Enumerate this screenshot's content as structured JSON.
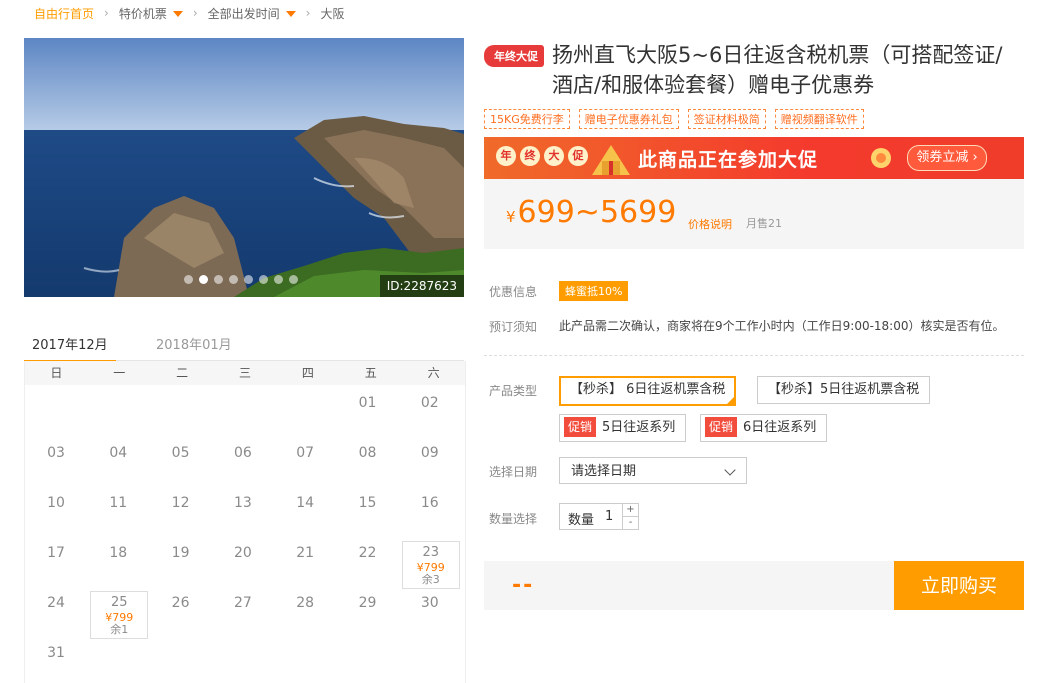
{
  "breadcrumb": {
    "home": "自由行首页",
    "items": [
      "特价机票",
      "全部出发时间",
      "大阪"
    ]
  },
  "gallery": {
    "image_id": "ID:2287623",
    "dots": 8,
    "active_dot": 1
  },
  "calendar": {
    "tabs": [
      "2017年12月",
      "2018年01月"
    ],
    "weekdays": [
      "日",
      "一",
      "二",
      "三",
      "四",
      "五",
      "六"
    ],
    "days": [
      {
        "n": "01"
      },
      {
        "n": "02"
      },
      {
        "n": "03"
      },
      {
        "n": "04"
      },
      {
        "n": "05"
      },
      {
        "n": "06"
      },
      {
        "n": "07"
      },
      {
        "n": "08"
      },
      {
        "n": "09"
      },
      {
        "n": "10"
      },
      {
        "n": "11"
      },
      {
        "n": "12"
      },
      {
        "n": "13"
      },
      {
        "n": "14"
      },
      {
        "n": "15"
      },
      {
        "n": "16"
      },
      {
        "n": "17"
      },
      {
        "n": "18"
      },
      {
        "n": "19"
      },
      {
        "n": "20"
      },
      {
        "n": "21"
      },
      {
        "n": "22"
      },
      {
        "n": "23",
        "price": "¥799",
        "remain": "余3"
      },
      {
        "n": "24"
      },
      {
        "n": "25",
        "price": "¥799",
        "remain": "余1"
      },
      {
        "n": "26"
      },
      {
        "n": "27"
      },
      {
        "n": "28"
      },
      {
        "n": "29"
      },
      {
        "n": "30"
      },
      {
        "n": "31"
      }
    ]
  },
  "product": {
    "badge": "年终大促",
    "title": "扬州直飞大阪5~6日往返含税机票（可搭配签证/酒店/和服体验套餐）赠电子优惠券",
    "tags": [
      "15KG免费行李",
      "赠电子优惠券礼包",
      "签证材料极简",
      "赠视频翻译软件"
    ],
    "banner": {
      "circles": [
        "年",
        "终",
        "大",
        "促"
      ],
      "text": "此商品正在参加大促",
      "button": "领券立减 ›"
    },
    "price_symbol": "¥",
    "price": "699~5699",
    "price_explain": "价格说明",
    "sold": "月售21"
  },
  "info": {
    "discount_label": "优惠信息",
    "discount_value": "蜂蜜抵10%",
    "notice_label": "预订须知",
    "notice_value": "此产品需二次确认，商家将在9个工作小时内（工作日9:00-18:00）核实是否有位。"
  },
  "options": {
    "type_label": "产品类型",
    "types": [
      "【秒杀】 6日往返机票含税",
      "【秒杀】5日往返机票含税"
    ],
    "promo_tag": "促销",
    "promos": [
      "5日往返系列",
      "6日往返系列"
    ],
    "date_label": "选择日期",
    "date_placeholder": "请选择日期",
    "qty_label": "数量选择",
    "qty_text": "数量",
    "qty_value": "1",
    "plus": "+",
    "minus": "-"
  },
  "purchase": {
    "total": "--",
    "buy_button": "立即购买"
  },
  "colors": {
    "accent": "#ff9d00",
    "price": "#ff7a00",
    "promo_red": "#f24c3d"
  }
}
